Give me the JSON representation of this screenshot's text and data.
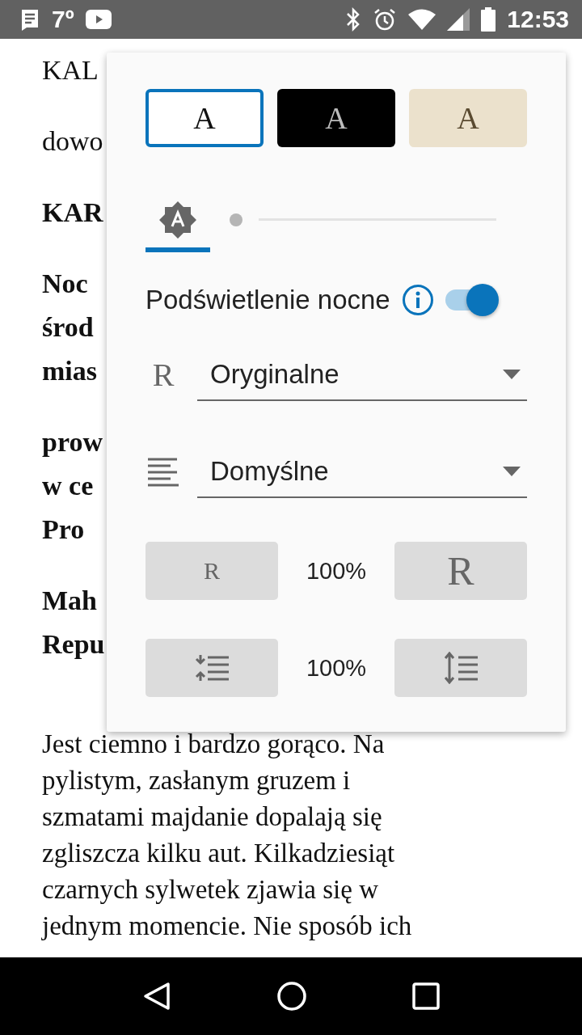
{
  "status_bar": {
    "temperature": "7º",
    "time": "12:53"
  },
  "article": {
    "paragraphs": [
      {
        "bold": false,
        "lines": [
          "KAL"
        ]
      },
      {
        "bold": false,
        "lines": [
          "dowo"
        ]
      },
      {
        "bold": true,
        "lines": [
          "KAR"
        ]
      },
      {
        "bold": true,
        "lines": [
          "Noc",
          "środ",
          "mias"
        ]
      },
      {
        "bold": true,
        "lines": [
          "prow",
          "w ce",
          "Pro"
        ]
      },
      {
        "bold": true,
        "lines": [
          "Mah",
          "Repu"
        ]
      },
      {
        "bold": false,
        "lines": [
          "Jest ciemno i bardzo gorąco. Na",
          "pylistym, zasłanym gruzem i",
          "szmatami majdanie dopalają się",
          "zgliszcza kilku aut. Kilkadziesiąt",
          "czarnych sylwetek zjawia się w",
          "jednym momencie. Nie sposób ich"
        ]
      }
    ]
  },
  "reader_settings": {
    "themes": [
      {
        "kind": "light",
        "label": "A",
        "selected": true
      },
      {
        "kind": "dark",
        "label": "A",
        "selected": false
      },
      {
        "kind": "sepia",
        "label": "A",
        "selected": false
      }
    ],
    "brightness": {
      "auto": true,
      "level": 0
    },
    "night_light": {
      "label": "Podświetlenie nocne",
      "on": true
    },
    "font": {
      "icon": "R",
      "value": "Oryginalne"
    },
    "alignment": {
      "value": "Domyślne"
    },
    "font_size": {
      "smaller": "R",
      "reading": "100%",
      "larger": "R"
    },
    "line_spacing": {
      "reading": "100%"
    }
  }
}
